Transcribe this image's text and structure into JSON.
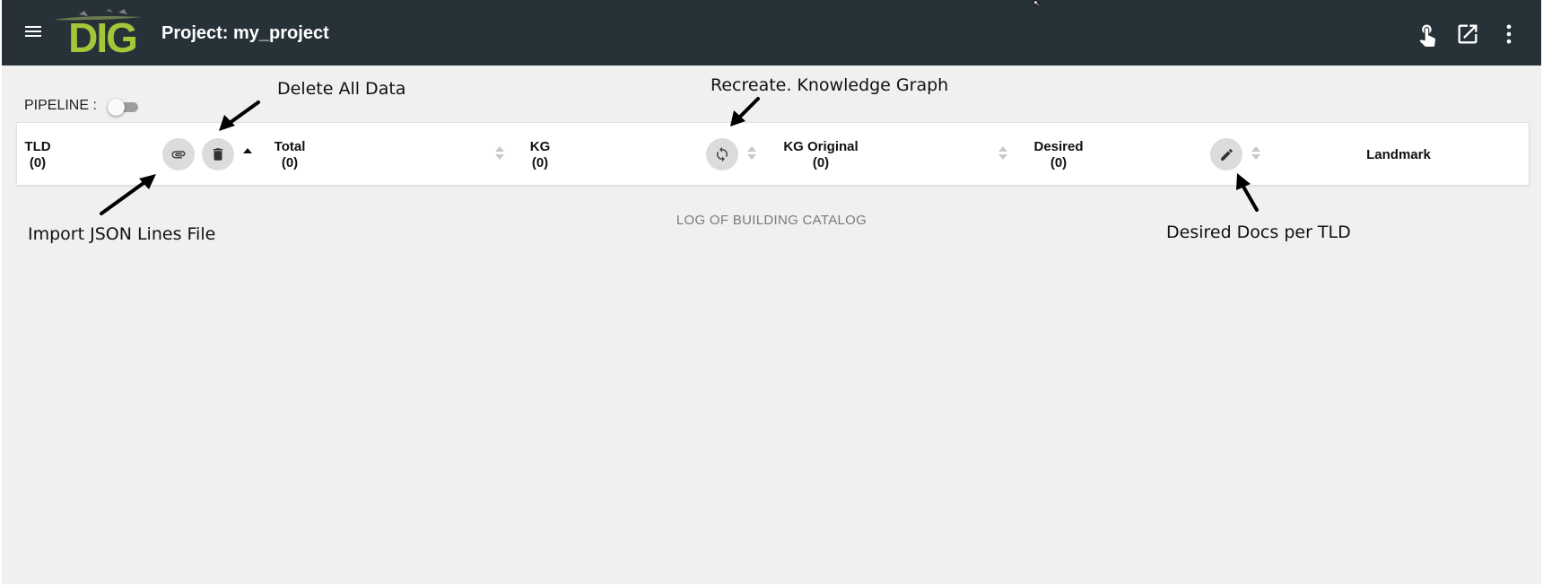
{
  "header": {
    "title": "Project: my_project",
    "logo_text": "DIG",
    "icons": [
      "menu-icon",
      "touch-app-icon",
      "open-in-new-icon",
      "more-vert-icon"
    ]
  },
  "pipeline": {
    "label": "PIPELINE :",
    "enabled": false
  },
  "table": {
    "columns": [
      {
        "label": "TLD",
        "count": "(0)"
      },
      {
        "label": "Total",
        "count": "(0)"
      },
      {
        "label": "KG",
        "count": "(0)"
      },
      {
        "label": "KG Original",
        "count": "(0)"
      },
      {
        "label": "Desired",
        "count": "(0)"
      },
      {
        "label": "Landmark"
      }
    ],
    "sorted_column": "TLD",
    "sort_direction": "ascending",
    "action_icons": [
      "attach-file-icon",
      "delete-icon",
      "refresh-icon",
      "edit-icon"
    ]
  },
  "log": {
    "title": "LOG OF BUILDING CATALOG"
  },
  "annotations": {
    "delete_all": "Delete All Data",
    "recreate_kg": "Recreate. Knowledge Graph",
    "import_jsonl": "Import JSON Lines File",
    "desired_docs": "Desired Docs per TLD"
  },
  "colors": {
    "appbar": "#263238",
    "background": "#f0f0f0",
    "logo_green": "#a4c639",
    "fab": "#dcdcdc"
  }
}
